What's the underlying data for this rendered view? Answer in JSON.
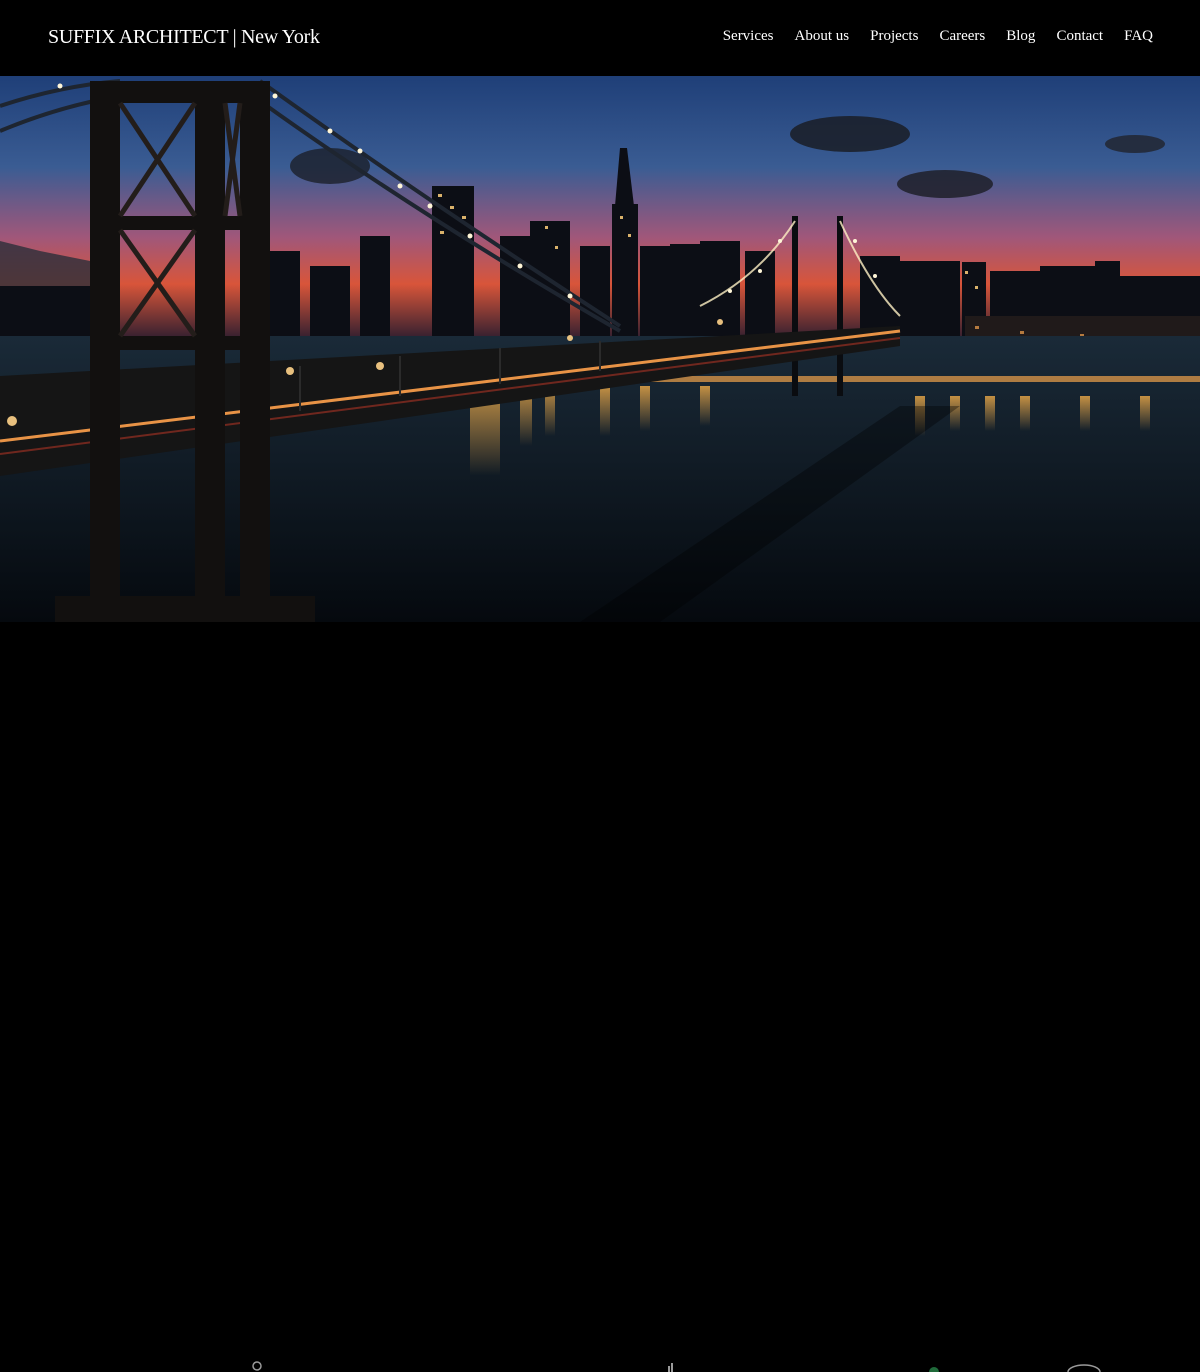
{
  "header": {
    "brand": "SUFFIX ARCHITECT | New York"
  },
  "nav": {
    "items": [
      {
        "label": "Services"
      },
      {
        "label": "About us"
      },
      {
        "label": "Projects"
      },
      {
        "label": "Careers"
      },
      {
        "label": "Blog"
      },
      {
        "label": "Contact"
      },
      {
        "label": "FAQ"
      }
    ]
  },
  "hero": {
    "image": "night-bridge-city-skyline",
    "colors": {
      "sky_top": "#2c4f88",
      "sky_horizon": "#d8553a",
      "water": "#0e1822",
      "light": "#ffb54a"
    }
  },
  "partners": {
    "icons": [
      "partner-logo-1-icon",
      "partner-logo-2-icon",
      "partner-logo-3-icon",
      "partner-logo-4-icon"
    ]
  }
}
